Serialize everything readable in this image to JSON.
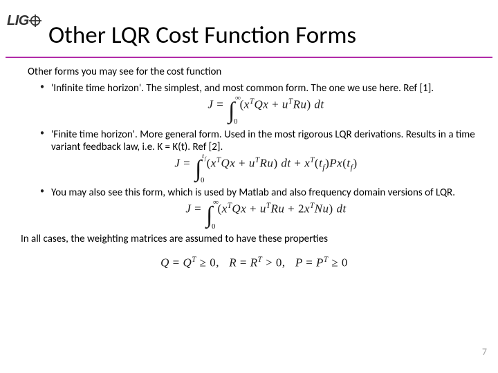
{
  "logo_text": "LIG",
  "page_title": "Other LQR Cost Function Forms",
  "lead": "Other forms you may see for the cost function",
  "bullets": [
    "'Infinite time horizon'. The simplest, and most common form. The one we use here. Ref [1].",
    "'Finite time horizon'. More general form. Used in the most rigorous LQR derivations. Results in a time variant feedback law, i.e. K = K(t). Ref [2].",
    "You may also see this form, which is used by Matlab and also frequency domain versions of LQR."
  ],
  "equations": {
    "eq1_lhs": "J = ",
    "eq1_ub": "∞",
    "eq1_lb": "0",
    "eq1_body": "( xᵀQx + uᵀRu ) dt",
    "eq2_ub": "t_f",
    "eq2_lb": "0",
    "eq2_body": "( xᵀQx + uᵀRu ) dt + xᵀ(t_f) P x(t_f)",
    "eq3_ub": "∞",
    "eq3_lb": "0",
    "eq3_body": "( xᵀQx + uᵀRu + 2xᵀNu ) dt"
  },
  "closing": "In all cases, the weighting matrices are assumed to have these properties",
  "prop_eq": "Q = Qᵀ ≥ 0,   R = Rᵀ > 0,   P = Pᵀ ≥ 0",
  "page_number": "7"
}
